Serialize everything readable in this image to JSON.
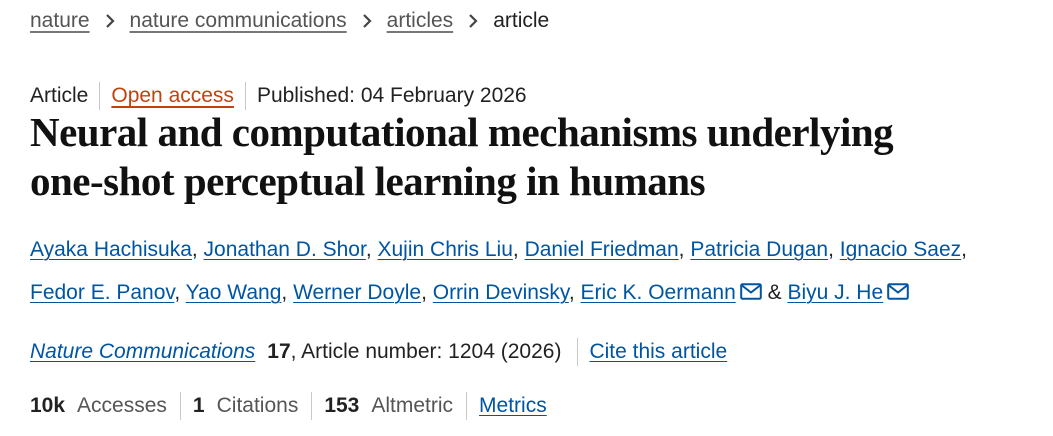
{
  "breadcrumb": {
    "items": [
      {
        "label": "nature"
      },
      {
        "label": "nature communications"
      },
      {
        "label": "articles"
      }
    ],
    "current": "article"
  },
  "meta": {
    "type": "Article",
    "access": "Open access",
    "published": "Published: 04 February 2026"
  },
  "article": {
    "title_line1": "Neural and computational mechanisms underlying",
    "title_line2": "one-shot perceptual learning in humans"
  },
  "authors": [
    {
      "name": "Ayaka Hachisuka",
      "sep": ", "
    },
    {
      "name": "Jonathan D. Shor",
      "sep": ", "
    },
    {
      "name": "Xujin Chris Liu",
      "sep": ", "
    },
    {
      "name": "Daniel Friedman",
      "sep": ", "
    },
    {
      "name": "Patricia Dugan",
      "sep": ", "
    },
    {
      "name": "Ignacio Saez",
      "sep": ", "
    },
    {
      "name": "Fedor E. Panov",
      "sep": ", "
    },
    {
      "name": "Yao Wang",
      "sep": ", "
    },
    {
      "name": "Werner Doyle",
      "sep": ", "
    },
    {
      "name": "Orrin Devinsky",
      "sep": ", "
    },
    {
      "name": "Eric K. Oermann",
      "sep": " & ",
      "corresponding": true
    },
    {
      "name": "Biyu J. He",
      "sep": "",
      "corresponding": true
    }
  ],
  "citation": {
    "journal": "Nature Communications",
    "volume": "17",
    "article_number": ", Article number: 1204 (2026)",
    "cite_label": "Cite this article"
  },
  "metrics": {
    "accesses_value": "10k",
    "accesses_label": "Accesses",
    "citations_value": "1",
    "citations_label": "Citations",
    "altmetric_value": "153",
    "altmetric_label": "Altmetric",
    "metrics_link": "Metrics"
  },
  "icons": {
    "breadcrumb_separator": "chevron-right-icon",
    "corresponding_author": "mail-icon"
  },
  "colors": {
    "link": "#0055a3",
    "open_access": "#c0430f",
    "text": "#222222"
  }
}
